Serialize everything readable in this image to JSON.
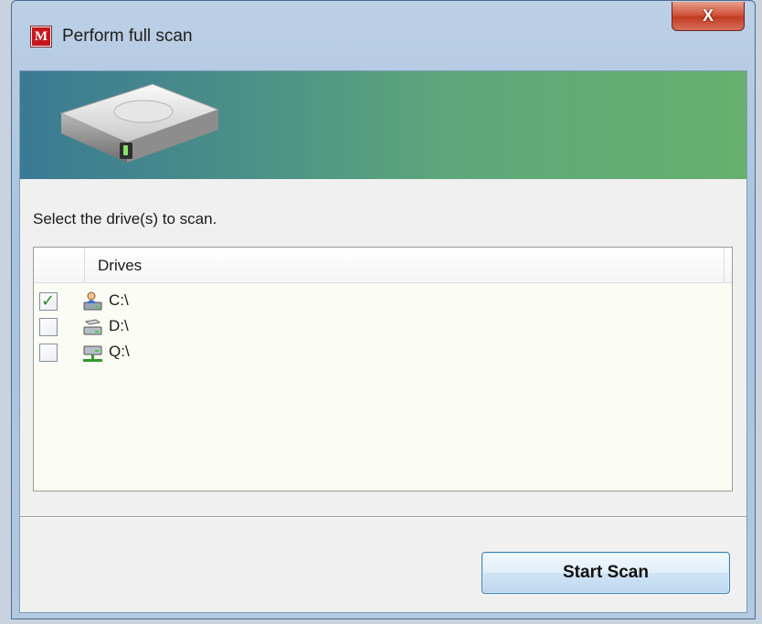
{
  "window": {
    "title": "Perform full scan",
    "app_icon": "mcafee-m-icon",
    "close_label": "X"
  },
  "banner": {
    "icon": "hard-drive-icon",
    "colors": {
      "start": "#3a7a93",
      "end": "#67b06e"
    }
  },
  "instruction": "Select the drive(s) to scan.",
  "list": {
    "column_header": "Drives",
    "rows": [
      {
        "label": "C:\\",
        "checked": true,
        "icon": "user-drive-icon"
      },
      {
        "label": "D:\\",
        "checked": false,
        "icon": "local-drive-icon"
      },
      {
        "label": "Q:\\",
        "checked": false,
        "icon": "network-drive-icon"
      }
    ]
  },
  "actions": {
    "start_scan_label": "Start Scan"
  }
}
